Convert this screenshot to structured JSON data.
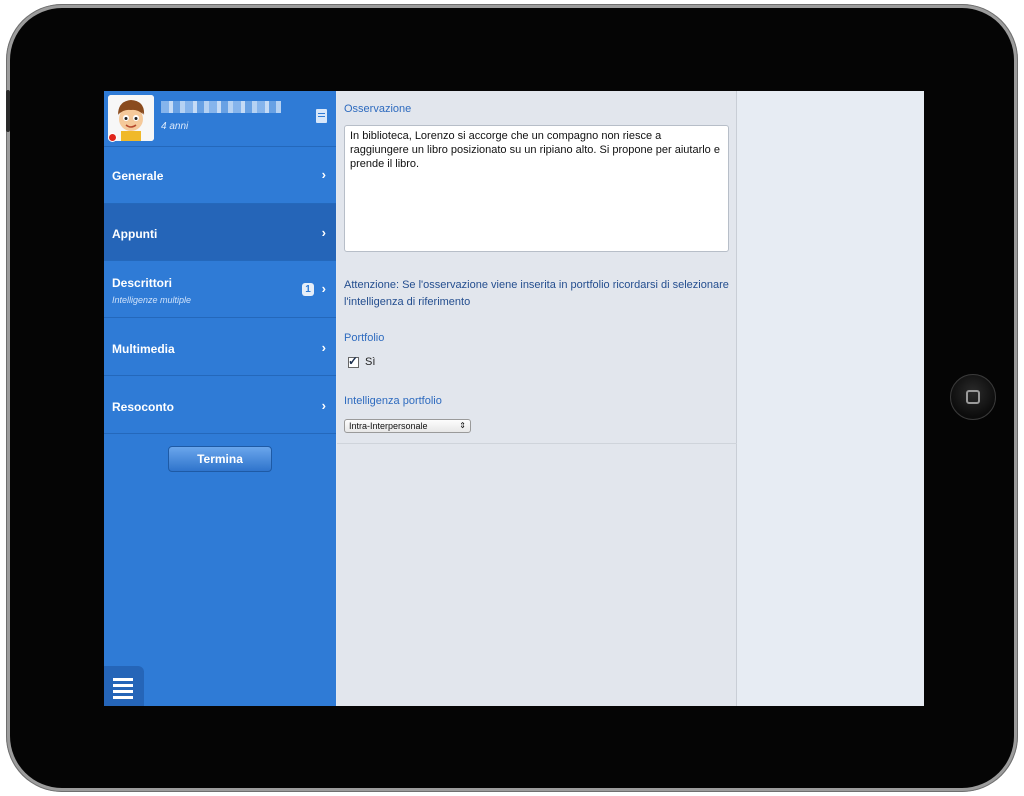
{
  "profile": {
    "age": "4 anni"
  },
  "nav": {
    "items": [
      {
        "label": "Generale",
        "sub": "",
        "badge": ""
      },
      {
        "label": "Appunti",
        "sub": "",
        "badge": ""
      },
      {
        "label": "Descrittori",
        "sub": "Intelligenze multiple",
        "badge": "1"
      },
      {
        "label": "Multimedia",
        "sub": "",
        "badge": ""
      },
      {
        "label": "Resoconto",
        "sub": "",
        "badge": ""
      }
    ],
    "active_index": 1,
    "chevron": "›"
  },
  "termina_label": "Termina",
  "form": {
    "observation_title": "Osservazione",
    "observation_text": "In biblioteca, Lorenzo si accorge che un compagno non riesce a raggiungere un libro posizionato su un ripiano alto. Si propone per aiutarlo e prende il libro.",
    "warning": "Attenzione: Se l'osservazione viene inserita in portfolio ricordarsi di selezionare l'intelligenza di riferimento",
    "portfolio_title": "Portfolio",
    "portfolio_checkbox_label": "Sì",
    "portfolio_checked": true,
    "intelligence_title": "Intelligenza portfolio",
    "intelligence_selected": "Intra-Interpersonale"
  },
  "colors": {
    "sidebar": "#2f7bd6",
    "sidebar_active": "#2565b8",
    "section_title": "#2e6bbf",
    "content_bg": "#e2e6ed"
  },
  "icons": [
    "document-icon",
    "chevron-right-icon",
    "hamburger-menu-icon",
    "home-button-icon"
  ]
}
